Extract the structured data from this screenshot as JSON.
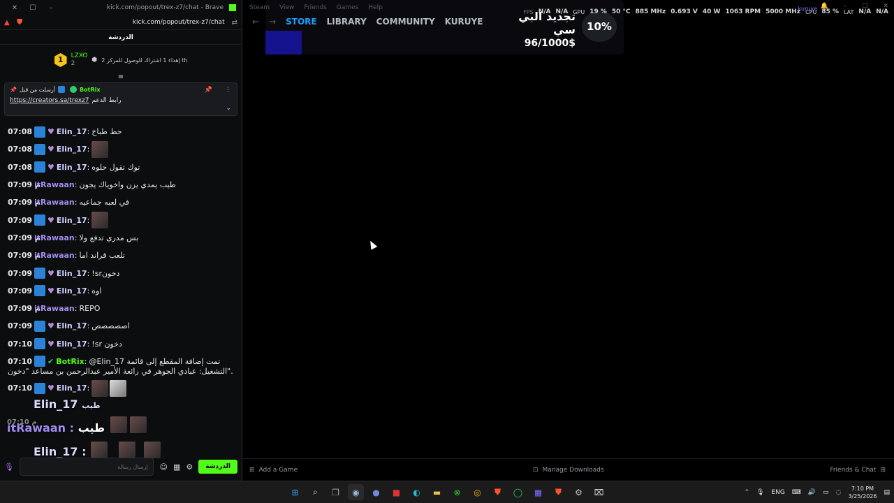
{
  "browser": {
    "window_title": "kick.com/popout/trex-z7/chat - Brave",
    "url": "kick.com/popout/trex-z7/chat"
  },
  "chat": {
    "header": "الدردشة",
    "leaderboard": {
      "rank": "1",
      "username": "LZXO",
      "count": "2",
      "goal_text": "إهداء 1 اشتراك للوصول للمركز 2 th"
    },
    "pinned": {
      "sent_by_label": "أرسلت من قبل",
      "bot_name": "BotRix",
      "label": "رابط الدعم",
      "link": "https://creators.sa/trexz7"
    },
    "messages": [
      {
        "time": "07:08 م",
        "user": "Elin_17",
        "type": "elin",
        "text": "حط طباخ"
      },
      {
        "time": "07:08 م",
        "user": "Elin_17",
        "type": "elin",
        "text": "",
        "emotes": 1
      },
      {
        "time": "07:08 م",
        "user": "Elin_17",
        "type": "elin",
        "text": "توك تقول حلوه"
      },
      {
        "time": "07:09 م",
        "user": "itRawaan",
        "type": "rawaan",
        "text": "طيب يمدي يزن واخوياك يجون"
      },
      {
        "time": "07:09 م",
        "user": "itRawaan",
        "type": "rawaan",
        "text": "في لعبه جماعيه"
      },
      {
        "time": "07:09 م",
        "user": "Elin_17",
        "type": "elin",
        "text": "",
        "emotes": 1
      },
      {
        "time": "07:09 م",
        "user": "itRawaan",
        "type": "rawaan",
        "text": "بس مدري تدفع ولا"
      },
      {
        "time": "07:09 م",
        "user": "itRawaan",
        "type": "rawaan",
        "text": "تلعب قراند اما"
      },
      {
        "time": "07:09 م",
        "user": "Elin_17",
        "type": "elin",
        "text": "!srدخون"
      },
      {
        "time": "07:09 م",
        "user": "Elin_17",
        "type": "elin",
        "text": "اوه"
      },
      {
        "time": "07:09 م",
        "user": "itRawaan",
        "type": "rawaan",
        "text": "REPO"
      },
      {
        "time": "07:09 م",
        "user": "Elin_17",
        "type": "elin",
        "text": "اصصصصص"
      },
      {
        "time": "07:10 م",
        "user": "Elin_17",
        "type": "elin",
        "text": "!sr دخون"
      },
      {
        "time": "07:10 م",
        "user": "BotRix",
        "type": "bot",
        "text": "@Elin_17 تمت إضافة المقطع إلى قائمة",
        "text2": "التشغيل: عبادي الجوهر في رائعة الأمير عبدالرحمن بن مساعد \"دخون\"."
      },
      {
        "time": "07:10 م",
        "user": "Elin_17",
        "type": "elin",
        "text": "",
        "emotes": 2
      }
    ],
    "overlay": {
      "line1_user": "Elin_17",
      "line1_text": "طيب",
      "line2_user": "itRawaan",
      "line2_text": "طيب",
      "line3_user": "Elin_17",
      "time_a": "07:10 م",
      "time_b": "07:10 م"
    },
    "input_placeholder": "إرسال رسالة",
    "send_button": "الدردشة"
  },
  "steam": {
    "menu": [
      "Steam",
      "View",
      "Friends",
      "Games",
      "Help"
    ],
    "nav": [
      "STORE",
      "LIBRARY",
      "COMMUNITY",
      "KURUYE"
    ],
    "renewal_title": "تجديد البي سي",
    "renewal_value": "96/1000$",
    "renewal_percent": 10,
    "renewal_percent_text": "10%",
    "hud": {
      "fps_label": "FPS",
      "fps_value": "N/A",
      "fps_value2": "N/A",
      "gpu_label": "GPU",
      "gpu_load": "19 %",
      "gpu_temp": "50 °C",
      "gpu_clock": "885 MHz",
      "gpu_volt": "0.693 V",
      "gpu_power": "40 W",
      "fan": "1063 RPM",
      "mem_clock": "5000 MHz",
      "cpu_label": "CPU",
      "cpu_load": "85 %",
      "lat_label": "LAT",
      "lat_value": "N/A",
      "lat_value2": "N/A",
      "account": "kuruye"
    },
    "bottom": {
      "add_game": "Add a Game",
      "downloads": "Manage Downloads",
      "friends": "Friends & Chat"
    }
  },
  "taskbar": {
    "lang": "ENG",
    "time": "7:10 PM",
    "date": "3/25/2026"
  }
}
